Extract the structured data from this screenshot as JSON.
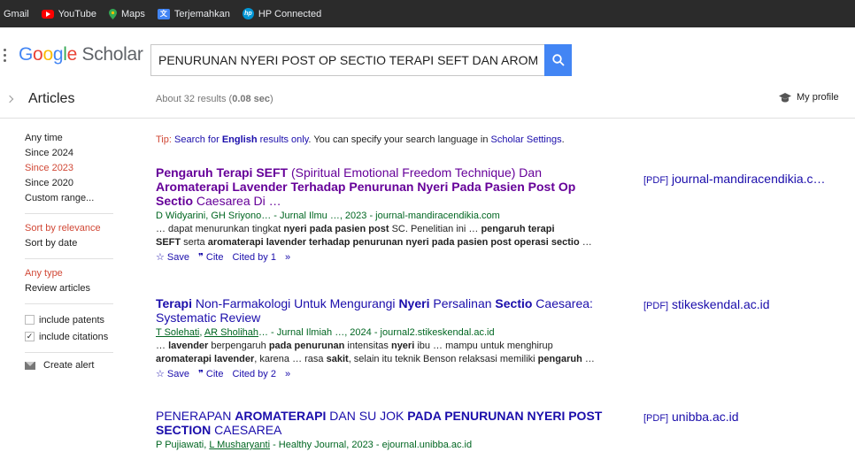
{
  "bookmarks": [
    {
      "label": "Gmail",
      "icon": "gmail-icon"
    },
    {
      "label": "YouTube",
      "icon": "youtube-icon"
    },
    {
      "label": "Maps",
      "icon": "maps-icon"
    },
    {
      "label": "Terjemahkan",
      "icon": "translate-icon"
    },
    {
      "label": "HP Connected",
      "icon": "hp-icon"
    }
  ],
  "logo": {
    "google": "Google",
    "scholar": "Scholar"
  },
  "search": {
    "value": "PENURUNAN NYERI POST OP SECTIO TERAPI SEFT DAN AROMATERAPI LAVENDER"
  },
  "results_bar": {
    "section": "Articles",
    "count_prefix": "About 32 results (",
    "count_time": "0.08 sec",
    "count_suffix": ")",
    "my_profile": "My profile"
  },
  "sidebar": {
    "time": [
      "Any time",
      "Since 2024",
      "Since 2023",
      "Since 2020",
      "Custom range..."
    ],
    "sort": [
      "Sort by relevance",
      "Sort by date"
    ],
    "type": [
      "Any type",
      "Review articles"
    ],
    "include_patents": "include patents",
    "include_citations": "include citations",
    "create_alert": "Create alert"
  },
  "tip": {
    "prefix": "Tip: ",
    "link1": "Search for ",
    "bold": "English",
    "link2": " results only",
    "middle": ". You can specify your search language in ",
    "link3": "Scholar Settings",
    "end": "."
  },
  "results": [
    {
      "title_parts": [
        {
          "t": "Pengaruh Terapi SEFT",
          "b": true
        },
        {
          "t": " (Spiritual Emotional Freedom Technique) Dan ",
          "b": false
        },
        {
          "t": "Aromaterapi Lavender Terhadap Penurunan Nyeri Pada Pasien Post Op Sectio",
          "b": true
        },
        {
          "t": " Caesarea Di …",
          "b": false
        }
      ],
      "meta": "D Widyarini, GH Sriyono… - Jurnal Ilmu …, 2023 - journal-mandiracendikia.com",
      "snippet1": "… dapat menurunkan tingkat <b>nyeri pada pasien post</b> SC. Penelitian ini … <b>pengaruh terapi</b>",
      "snippet2": "<b>SEFT</b> serta <b>aromaterapi lavender terhadap penurunan nyeri pada pasien post operasi sectio</b> …",
      "save": "Save",
      "cite": "Cite",
      "cited_by": "Cited by 1",
      "pdf_tag": "[PDF]",
      "pdf_domain": "journal-mandiracendikia.c…"
    },
    {
      "title_parts": [
        {
          "t": "Terapi",
          "b": true
        },
        {
          "t": " Non-Farmakologi Untuk Mengurangi ",
          "b": false
        },
        {
          "t": "Nyeri",
          "b": true
        },
        {
          "t": " Persalinan ",
          "b": false
        },
        {
          "t": "Sectio",
          "b": true
        },
        {
          "t": " Caesarea: Systematic Review",
          "b": false
        }
      ],
      "meta_authors": [
        "T Solehati",
        "AR Sholihah"
      ],
      "meta_rest": "… - Jurnal Ilmiah …, 2024 - journal2.stikeskendal.ac.id",
      "snippet1": "… <b>lavender</b> berpengaruh <b>pada penurunan</b> intensitas <b>nyeri</b> ibu … mampu untuk menghirup",
      "snippet2": "<b>aromaterapi lavender</b>, karena … rasa <b>sakit</b>, selain itu teknik Benson relaksasi memiliki <b>pengaruh</b> …",
      "save": "Save",
      "cite": "Cite",
      "cited_by": "Cited by 2",
      "pdf_tag": "[PDF]",
      "pdf_domain": "stikeskendal.ac.id"
    },
    {
      "title_parts": [
        {
          "t": "PENERAPAN ",
          "b": false
        },
        {
          "t": "AROMATERAPI",
          "b": true
        },
        {
          "t": " DAN SU JOK ",
          "b": false
        },
        {
          "t": "PADA PENURUNAN NYERI POST SECTION",
          "b": true
        },
        {
          "t": " CAESAREA",
          "b": false
        }
      ],
      "meta_first": "P Pujiawati, ",
      "meta_author2": "L Musharyanti",
      "meta_rest": " - Healthy Journal, 2023 - ejournal.unibba.ac.id",
      "pdf_tag": "[PDF]",
      "pdf_domain": "unibba.ac.id"
    }
  ],
  "colors": {
    "accent": "#4285f4",
    "link": "#1a0dab",
    "visited": "#660099",
    "active": "#d14836",
    "meta": "#006621"
  }
}
